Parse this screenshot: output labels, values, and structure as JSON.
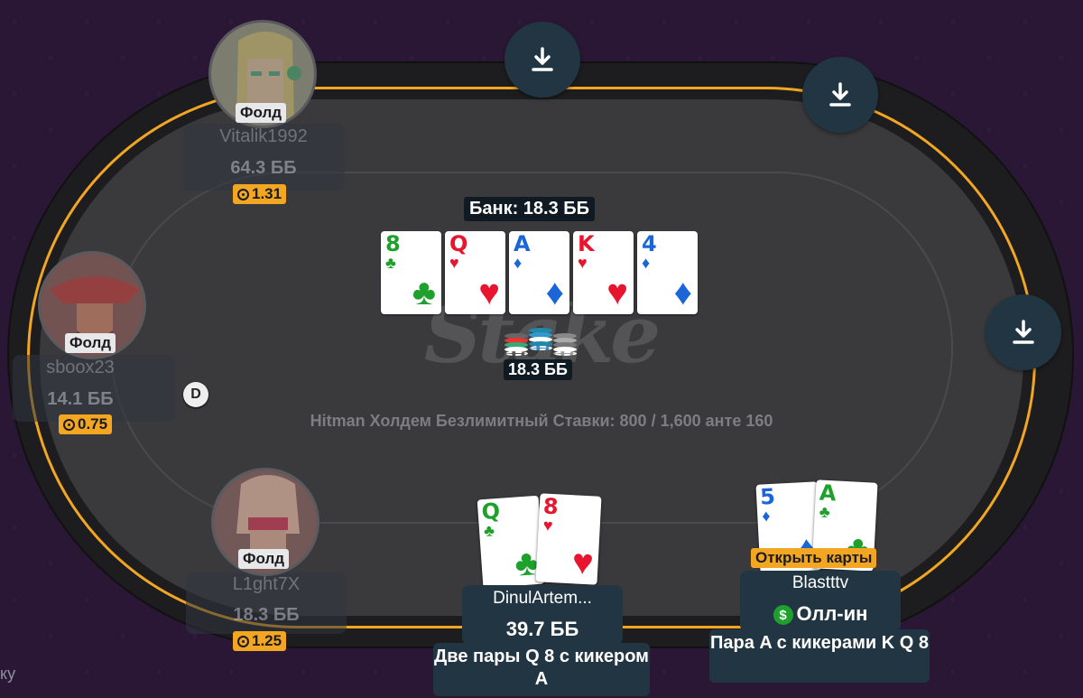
{
  "table": {
    "info": "Hitman Холдем Безлимитный Ставки: 800 / 1,600 анте 160",
    "watermark": "Stake",
    "pot_label": "Банк: 18.3 ББ",
    "pot_amount": "18.3 ББ",
    "dealer": "D",
    "colors": {
      "rim": "#f2a621",
      "felt": "#3a3a3c",
      "panel": "#213642"
    }
  },
  "board": [
    {
      "rank": "8",
      "suit": "♣",
      "color": "green"
    },
    {
      "rank": "Q",
      "suit": "♥",
      "color": "red"
    },
    {
      "rank": "A",
      "suit": "♦",
      "color": "blue"
    },
    {
      "rank": "K",
      "suit": "♥",
      "color": "red"
    },
    {
      "rank": "4",
      "suit": "♦",
      "color": "blue"
    }
  ],
  "players": {
    "vitalik": {
      "name": "Vitalik1992",
      "stack": "64.3 ББ",
      "status": "Фолд",
      "bet": "1.31"
    },
    "sboox": {
      "name": "sboox23",
      "stack": "14.1 ББ",
      "status": "Фолд",
      "bet": "0.75"
    },
    "light": {
      "name": "L1ght7X",
      "stack": "18.3 ББ",
      "status": "Фолд",
      "bet": "1.25"
    },
    "dinul": {
      "name": "DinulArtem...",
      "stack": "39.7 ББ",
      "hand": "Две пары Q 8 с кикером A",
      "cards": [
        {
          "rank": "Q",
          "suit": "♣",
          "color": "green"
        },
        {
          "rank": "8",
          "suit": "♥",
          "color": "red"
        }
      ]
    },
    "blast": {
      "name": "Blastttv",
      "status": "Олл-ин",
      "show": "Открыть карты",
      "hand": "Пара A с кикерами K Q 8",
      "cards": [
        {
          "rank": "5",
          "suit": "♦",
          "color": "blue"
        },
        {
          "rank": "A",
          "suit": "♣",
          "color": "green"
        }
      ]
    }
  },
  "icons": {
    "download": "download-icon",
    "bet": "chip-target-icon",
    "allin": "dollar-icon"
  },
  "corner_text": "ку"
}
